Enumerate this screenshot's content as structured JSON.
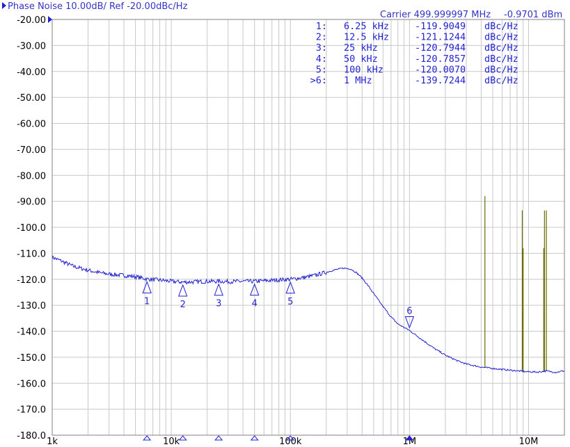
{
  "header": {
    "title": "Phase Noise 10.00dB/ Ref -20.00dBc/Hz",
    "carrier_label": "Carrier 499.999997 MHz",
    "carrier_power": "-0.9701 dBm"
  },
  "marker_table": [
    {
      "id": "1:",
      "freq": "6.25 kHz",
      "value": "-119.9049",
      "unit": "dBc/Hz"
    },
    {
      "id": "2:",
      "freq": "12.5 kHz",
      "value": "-121.1244",
      "unit": "dBc/Hz"
    },
    {
      "id": "3:",
      "freq": "25 kHz",
      "value": "-120.7944",
      "unit": "dBc/Hz"
    },
    {
      "id": "4:",
      "freq": "50 kHz",
      "value": "-120.7857",
      "unit": "dBc/Hz"
    },
    {
      "id": "5:",
      "freq": "100 kHz",
      "value": "-120.0070",
      "unit": "dBc/Hz"
    },
    {
      "id": ">6:",
      "freq": "1 MHz",
      "value": "-139.7244",
      "unit": "dBc/Hz"
    }
  ],
  "colors": {
    "trace": "#2020d0",
    "spurs": "#6a6a00",
    "grid": "#c8c8c8",
    "text": "#3434c8"
  },
  "chart_data": {
    "type": "line",
    "xscale": "log",
    "xlim": [
      1000,
      20000000
    ],
    "ylim": [
      -180,
      -20
    ],
    "grid": true,
    "yticks": [
      -20,
      -30,
      -40,
      -50,
      -60,
      -70,
      -80,
      -90,
      -100,
      -110,
      -120,
      -130,
      -140,
      -150,
      -160,
      -170,
      -180
    ],
    "ytick_labels": [
      "-20.00",
      "-30.00",
      "-40.00",
      "-50.00",
      "-60.00",
      "-70.00",
      "-80.00",
      "-90.00",
      "-100.0",
      "-110.0",
      "-120.0",
      "-130.0",
      "-140.0",
      "-150.0",
      "-160.0",
      "-170.0",
      "-180.0"
    ],
    "xticks": [
      1000,
      10000,
      100000,
      1000000,
      10000000
    ],
    "xtick_labels": [
      "1k",
      "10k",
      "100k",
      "1M",
      "10M"
    ],
    "series": [
      {
        "x": [
          1000,
          1200,
          1500,
          2000,
          2500,
          3000,
          4000,
          5000,
          6250,
          8000,
          10000,
          12500,
          16000,
          20000,
          25000,
          32000,
          40000,
          50000,
          65000,
          80000,
          100000,
          130000,
          160000,
          200000,
          240000,
          280000,
          320000,
          360000,
          400000,
          450000,
          500000,
          600000,
          700000,
          800000,
          1000000,
          1300000,
          1600000,
          2000000,
          2500000,
          3000000,
          4000000,
          5000000,
          6000000,
          7000000,
          8000000,
          9000000,
          10000000,
          12000000,
          14000000,
          17000000,
          20000000
        ],
        "y": [
          -111.5,
          -113,
          -115,
          -116.5,
          -117.5,
          -118,
          -118.5,
          -119,
          -119.9,
          -120.3,
          -120.8,
          -121.1,
          -121,
          -120.8,
          -120.8,
          -120.9,
          -120.8,
          -120.8,
          -120.5,
          -120.2,
          -120,
          -119.3,
          -118.5,
          -117.3,
          -116.3,
          -115.7,
          -116,
          -117.5,
          -119.5,
          -122.5,
          -125.5,
          -130.5,
          -134.5,
          -137.2,
          -139.7,
          -143.5,
          -146.5,
          -149.2,
          -151.3,
          -152.6,
          -153.8,
          -154.3,
          -154.7,
          -155,
          -155.2,
          -155.5,
          -155.6,
          -155.7,
          -155.3,
          -155.8,
          -155.2
        ]
      }
    ],
    "spurs": [
      {
        "x": 4300000,
        "y": -88
      },
      {
        "x": 8850000,
        "y": -93.5
      },
      {
        "x": 9000000,
        "y": -108
      },
      {
        "x": 13600000,
        "y": -93.5
      },
      {
        "x": 14100000,
        "y": -93.5
      },
      {
        "x": 13400000,
        "y": -108
      }
    ],
    "markers": [
      {
        "label": "1",
        "x": 6250,
        "y": -119.9049,
        "direction": "below"
      },
      {
        "label": "2",
        "x": 12500,
        "y": -121.1244,
        "direction": "below"
      },
      {
        "label": "3",
        "x": 25000,
        "y": -120.7944,
        "direction": "below"
      },
      {
        "label": "4",
        "x": 50000,
        "y": -120.7857,
        "direction": "below"
      },
      {
        "label": "5",
        "x": 100000,
        "y": -120.007,
        "direction": "below"
      },
      {
        "label": "6",
        "x": 1000000,
        "y": -139.7244,
        "direction": "above"
      }
    ]
  }
}
